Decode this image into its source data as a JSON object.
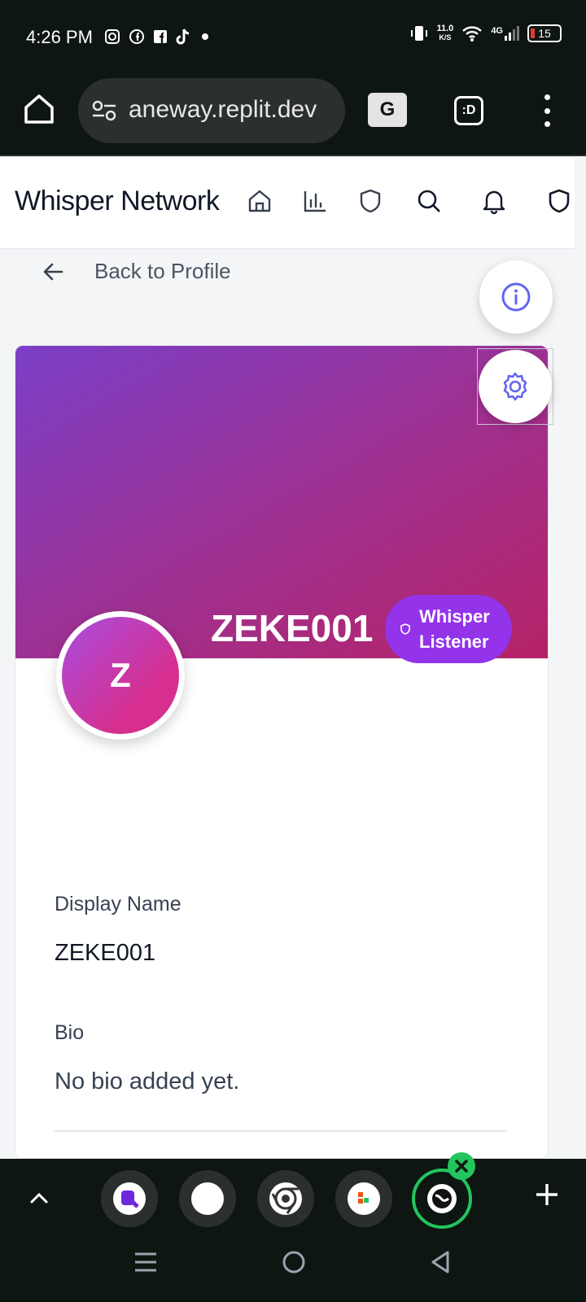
{
  "status_bar": {
    "time": "4:26 PM",
    "left_icons": [
      "instagram-icon",
      "facebook-icon",
      "facebook-square-icon",
      "tiktok-icon",
      "dot-icon"
    ],
    "speed_value": "11.0",
    "speed_unit": "K/S",
    "network": "4G",
    "battery": "15"
  },
  "browser": {
    "url": "aneway.replit.dev",
    "translate_label": "G",
    "tab_label": ":D"
  },
  "app": {
    "brand": "Whisper Network",
    "nav_icons": [
      "home-icon",
      "bar-chart-icon",
      "shield-icon",
      "search-icon",
      "bell-icon",
      "shield-icon"
    ]
  },
  "back": {
    "label": "Back to Profile"
  },
  "profile": {
    "avatar_initial": "Z",
    "username": "ZEKE001",
    "badge_line1": "Whisper",
    "badge_line2": "Listener",
    "display_name_label": "Display Name",
    "display_name_value": "ZEKE001",
    "bio_label": "Bio",
    "bio_value": "No bio added yet."
  },
  "colors": {
    "accent": "#6366f1",
    "badge": "#9333ea",
    "cover_start": "#7b3fc7",
    "cover_end": "#b52266",
    "active_app": "#22c55e"
  }
}
